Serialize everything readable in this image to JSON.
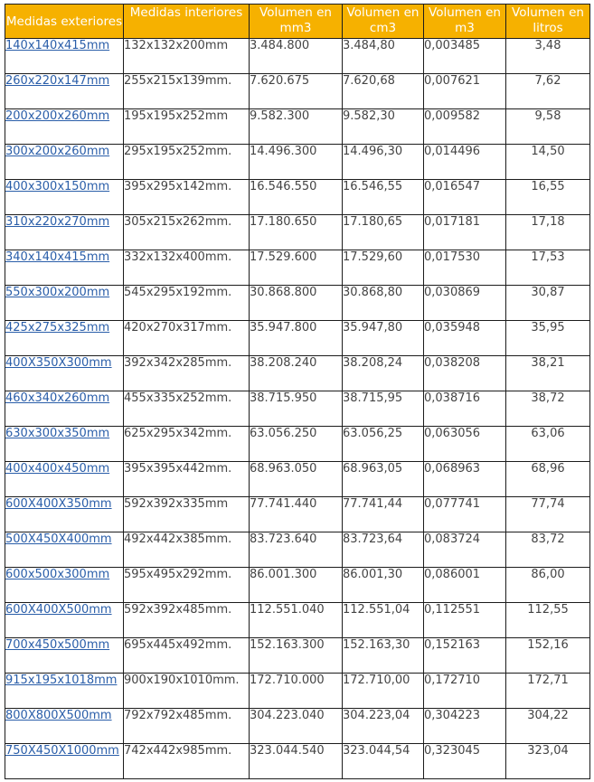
{
  "table": {
    "headers": [
      "Medidas exteriores",
      "Medidas interiores",
      "Volumen en mm3",
      "Volumen en cm3",
      "Volumen en m3",
      "Volumen en litros"
    ],
    "rows": [
      {
        "ext": "140x140x415mm",
        "int": "132x132x200mm",
        "mm3": "3.484.800",
        "cm3": "3.484,80",
        "m3": "0,003485",
        "litros": "3,48"
      },
      {
        "ext": "260x220x147mm",
        "int": "255x215x139mm.",
        "mm3": "7.620.675",
        "cm3": "7.620,68",
        "m3": "0,007621",
        "litros": "7,62"
      },
      {
        "ext": "200x200x260mm",
        "int": "195x195x252mm",
        "mm3": "9.582.300",
        "cm3": "9.582,30",
        "m3": "0,009582",
        "litros": "9,58"
      },
      {
        "ext": "300x200x260mm",
        "int": "295x195x252mm.",
        "mm3": "14.496.300",
        "cm3": "14.496,30",
        "m3": "0,014496",
        "litros": "14,50"
      },
      {
        "ext": "400x300x150mm",
        "int": "395x295x142mm.",
        "mm3": "16.546.550",
        "cm3": "16.546,55",
        "m3": "0,016547",
        "litros": "16,55"
      },
      {
        "ext": "310x220x270mm",
        "int": "305x215x262mm.",
        "mm3": "17.180.650",
        "cm3": "17.180,65",
        "m3": "0,017181",
        "litros": "17,18"
      },
      {
        "ext": "340x140x415mm",
        "int": "332x132x400mm.",
        "mm3": "17.529.600",
        "cm3": "17.529,60",
        "m3": "0,017530",
        "litros": "17,53"
      },
      {
        "ext": "550x300x200mm",
        "int": "545x295x192mm.",
        "mm3": "30.868.800",
        "cm3": "30.868,80",
        "m3": "0,030869",
        "litros": "30,87"
      },
      {
        "ext": "425x275x325mm",
        "int": "420x270x317mm.",
        "mm3": "35.947.800",
        "cm3": "35.947,80",
        "m3": "0,035948",
        "litros": "35,95"
      },
      {
        "ext": "400X350X300mm",
        "int": "392x342x285mm.",
        "mm3": "38.208.240",
        "cm3": "38.208,24",
        "m3": "0,038208",
        "litros": "38,21"
      },
      {
        "ext": "460x340x260mm",
        "int": "455x335x252mm.",
        "mm3": "38.715.950",
        "cm3": "38.715,95",
        "m3": "0,038716",
        "litros": "38,72"
      },
      {
        "ext": "630x300x350mm",
        "int": "625x295x342mm.",
        "mm3": "63.056.250",
        "cm3": "63.056,25",
        "m3": "0,063056",
        "litros": "63,06"
      },
      {
        "ext": "400x400x450mm",
        "int": "395x395x442mm.",
        "mm3": "68.963.050",
        "cm3": "68.963,05",
        "m3": "0,068963",
        "litros": "68,96"
      },
      {
        "ext": "600X400X350mm",
        "int": "592x392x335mm",
        "mm3": "77.741.440",
        "cm3": "77.741,44",
        "m3": "0,077741",
        "litros": "77,74"
      },
      {
        "ext": "500X450X400mm",
        "int": "492x442x385mm.",
        "mm3": "83.723.640",
        "cm3": "83.723,64",
        "m3": "0,083724",
        "litros": "83,72"
      },
      {
        "ext": "600x500x300mm",
        "int": "595x495x292mm.",
        "mm3": "86.001.300",
        "cm3": "86.001,30",
        "m3": "0,086001",
        "litros": "86,00"
      },
      {
        "ext": "600X400X500mm",
        "int": "592x392x485mm.",
        "mm3": "112.551.040",
        "cm3": "112.551,04",
        "m3": "0,112551",
        "litros": "112,55"
      },
      {
        "ext": "700x450x500mm",
        "int": "695x445x492mm.",
        "mm3": "152.163.300",
        "cm3": "152.163,30",
        "m3": "0,152163",
        "litros": "152,16"
      },
      {
        "ext": "915x195x1018mm",
        "int": "900x190x1010mm.",
        "mm3": "172.710.000",
        "cm3": "172.710,00",
        "m3": "0,172710",
        "litros": "172,71"
      },
      {
        "ext": "800X800X500mm",
        "int": "792x792x485mm.",
        "mm3": "304.223.040",
        "cm3": "304.223,04",
        "m3": "0,304223",
        "litros": "304,22"
      },
      {
        "ext": "750X450X1000mm",
        "int": "742x442x985mm.",
        "mm3": "323.044.540",
        "cm3": "323.044,54",
        "m3": "0,323045",
        "litros": "323,04"
      }
    ]
  }
}
